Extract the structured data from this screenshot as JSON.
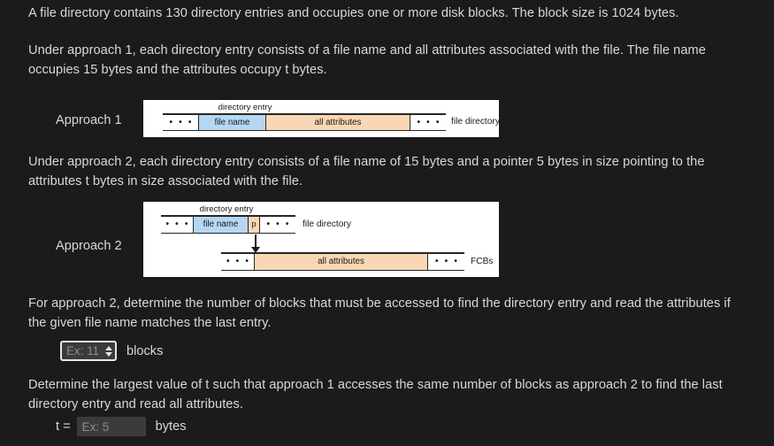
{
  "problem": {
    "intro": "A file directory contains 130 directory entries and occupies one or more disk blocks. The block size is 1024 bytes.",
    "approach1_desc": "Under approach 1, each directory entry consists of a file name and all attributes associated with the file. The file name occupies 15 bytes and the attributes occupy t bytes.",
    "approach2_desc": "Under approach 2, each directory entry consists of a file name of 15 bytes and a pointer 5 bytes in size pointing to the attributes t bytes in size associated with the file.",
    "question1": "For approach 2, determine the number of blocks that must be accessed to find the directory entry and read the attributes if the given file name matches the last entry.",
    "question2": "Determine the largest value of t such that approach 1 accesses the same number of blocks as approach 2 to find the last directory entry and read all attributes."
  },
  "figures": {
    "approach1": {
      "label": "Approach 1",
      "entry_caption": "directory entry",
      "cells": [
        {
          "text": "• • •",
          "kind": "ellipsis"
        },
        {
          "text": "file name",
          "kind": "filename"
        },
        {
          "text": "all attributes",
          "kind": "attrs"
        },
        {
          "text": "• • •",
          "kind": "ellipsis"
        }
      ],
      "side_caption": "file directory"
    },
    "approach2": {
      "label": "Approach 2",
      "entry_caption": "directory entry",
      "top_cells": [
        {
          "text": "• • •",
          "kind": "ellipsis"
        },
        {
          "text": "file name",
          "kind": "filename"
        },
        {
          "text": "p",
          "kind": "ptr"
        },
        {
          "text": "• • •",
          "kind": "ellipsis"
        }
      ],
      "top_side_caption": "file directory",
      "bottom_cells": [
        {
          "text": "• • •",
          "kind": "ellipsis"
        },
        {
          "text": "all attributes",
          "kind": "attrs"
        },
        {
          "text": "• • •",
          "kind": "ellipsis"
        }
      ],
      "bottom_side_caption": "FCBs"
    }
  },
  "answers": {
    "blocks": {
      "value": "",
      "placeholder": "Ex: 11",
      "unit": "blocks"
    },
    "t": {
      "prefix": "t =",
      "value": "",
      "placeholder": "Ex: 5",
      "unit": "bytes"
    }
  },
  "colors": {
    "background": "#1b1b1d",
    "text": "#dcd8d0",
    "filename_fill": "#b5d7f2",
    "attributes_fill": "#f9d7b5",
    "figure_bg": "#ffffff",
    "input_bg": "#3b3b3b",
    "input_border": "#e8e8e8",
    "placeholder": "#8d8d8d"
  }
}
